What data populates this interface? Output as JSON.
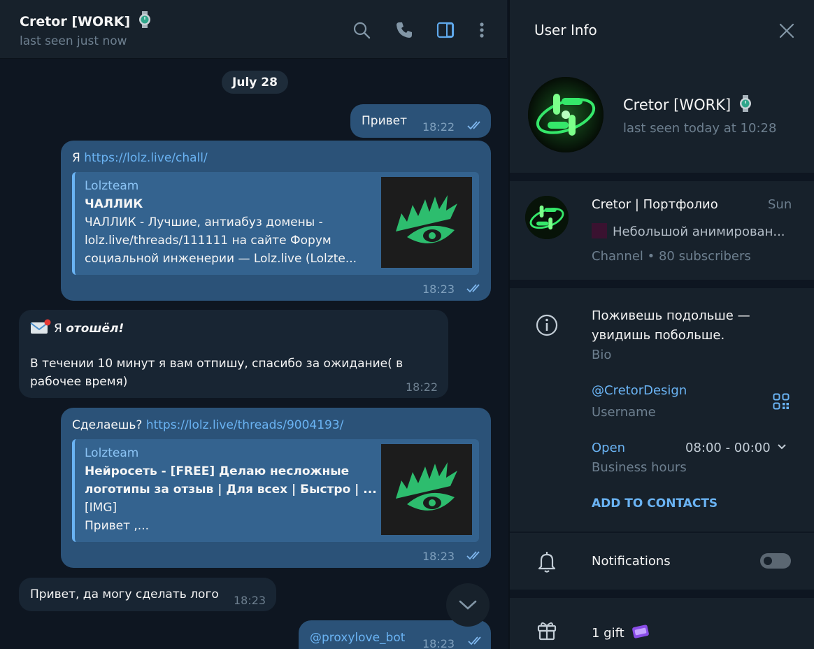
{
  "chat": {
    "title": "Cretor [WORK]",
    "status": "last seen just now",
    "date_chip": "July 28",
    "messages": {
      "m1": {
        "text": "Привет",
        "time": "18:22"
      },
      "m2": {
        "prefix": "Я ",
        "link": "https://lolz.live/chall/",
        "time": "18:23",
        "preview": {
          "site": "Lolzteam",
          "title": "ЧАЛЛИК",
          "lines": [
            "ЧАЛЛИК - Лучшие, антиабуз домены -",
            "lolz.live/threads/111111 на сайте Форум",
            "социальной инженерии —  Lolz.live (Lolzte..."
          ]
        }
      },
      "m3": {
        "prefix": "Я ",
        "bold": "отошёл!",
        "text": "В течении 10 минут я  вам отпишу, спасибо за ожидание( в",
        "text2": "рабочее время)",
        "time": "18:22"
      },
      "m4": {
        "prefix": "Сделаешь? ",
        "link": "https://lolz.live/threads/9004193/",
        "time": "18:23",
        "preview": {
          "site": "Lolzteam",
          "title1": "Нейросеть - [FREE] Делаю несложные",
          "title2": "логотипы за отзыв | Для всех | Быстро | ...",
          "line1": "[IMG]",
          "line2": "Привет ,..."
        }
      },
      "m5": {
        "text": "Привет, да могу сделать лого",
        "time": "18:23"
      },
      "m6": {
        "text": "@proxylove_bot",
        "time": "18:23"
      }
    }
  },
  "info": {
    "title": "User Info",
    "name": "Cretor [WORK]",
    "last_seen": "last seen today at 10:28",
    "channel": {
      "name": "Cretor | Портфолио",
      "date": "Sun",
      "last_message": "Небольшой анимирован...",
      "subscribers": "Channel • 80 subscribers"
    },
    "bio": {
      "line1": "Поживешь подольше —",
      "line2": "увидишь побольше.",
      "label": "Bio"
    },
    "username": {
      "value": "@CretorDesign",
      "label": "Username"
    },
    "business": {
      "status": "Open",
      "hours": "08:00 - 00:00",
      "label": "Business hours"
    },
    "add_contacts": "ADD TO CONTACTS",
    "notifications": {
      "label": "Notifications",
      "enabled": false
    },
    "gifts": "1 gift"
  },
  "colors": {
    "accent": "#6ab3f3",
    "outgoing_bubble": "#2b5278",
    "incoming_bubble": "#182533",
    "panel": "#17212b",
    "background": "#0e1621",
    "avatar_glow": "#35e86a"
  },
  "icons": [
    "watch-emoji-icon",
    "search-icon",
    "phone-icon",
    "sidebar-toggle-icon",
    "more-vertical-icon",
    "close-icon",
    "info-icon",
    "qr-code-icon",
    "bell-icon",
    "gift-icon",
    "envelope-emoji-icon",
    "double-check-icon",
    "chevron-down-icon"
  ]
}
